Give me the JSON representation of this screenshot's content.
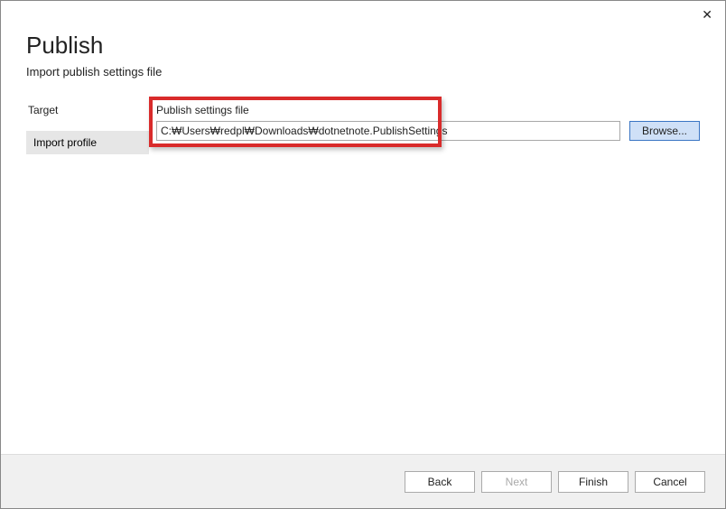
{
  "header": {
    "title": "Publish",
    "subtitle": "Import publish settings file"
  },
  "sidebar": {
    "label": "Target",
    "items": [
      {
        "label": "Import profile",
        "selected": true
      }
    ]
  },
  "main": {
    "fieldLabel": "Publish settings file",
    "fieldValue": "C:₩Users₩redpl₩Downloads₩dotnetnote.PublishSettings",
    "browseLabel": "Browse..."
  },
  "footer": {
    "back": "Back",
    "next": "Next",
    "finish": "Finish",
    "cancel": "Cancel"
  },
  "closeGlyph": "✕"
}
